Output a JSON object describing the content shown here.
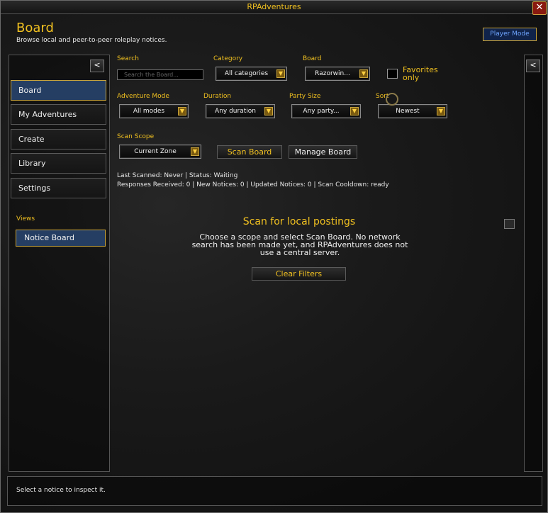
{
  "window": {
    "title": "RPAdventures"
  },
  "header": {
    "title": "Board",
    "subtitle": "Browse local and peer-to-peer roleplay notices.",
    "player_mode": "Player Mode"
  },
  "sidebar": {
    "collapse": "<",
    "items": [
      {
        "label": "Board"
      },
      {
        "label": "My Adventures"
      },
      {
        "label": "Create"
      },
      {
        "label": "Library"
      },
      {
        "label": "Settings"
      }
    ],
    "views_label": "Views",
    "notice_board": "Notice Board"
  },
  "right_panel": {
    "collapse": "<"
  },
  "filters": {
    "search": {
      "label": "Search",
      "placeholder": "Search the Board..."
    },
    "category": {
      "label": "Category",
      "value": "All categories"
    },
    "board": {
      "label": "Board",
      "value": "Razorwin..."
    },
    "favorites": {
      "label": "Favorites only"
    },
    "adventure_mode": {
      "label": "Adventure Mode",
      "value": "All modes"
    },
    "duration": {
      "label": "Duration",
      "value": "Any duration"
    },
    "party_size": {
      "label": "Party Size",
      "value": "Any party..."
    },
    "sort": {
      "label": "Sort",
      "value": "Newest"
    },
    "scan_scope": {
      "label": "Scan Scope",
      "value": "Current Zone"
    }
  },
  "actions": {
    "scan_board": "Scan Board",
    "manage_board": "Manage Board",
    "clear_filters": "Clear Filters"
  },
  "status": {
    "line1": "Last Scanned: Never  |  Status: Waiting",
    "line2": "Responses Received: 0  |  New Notices: 0  |  Updated Notices: 0  |  Scan Cooldown: ready"
  },
  "empty_state": {
    "title": "Scan for local postings",
    "body": "Choose a scope and select Scan Board. No network search has been made yet, and RPAdventures does not use a central server."
  },
  "footer": {
    "text": "Select a notice to inspect it."
  },
  "colors": {
    "gold": "#f0c020",
    "active_blue": "#253e63",
    "player_mode_text": "#6fa6ff"
  }
}
